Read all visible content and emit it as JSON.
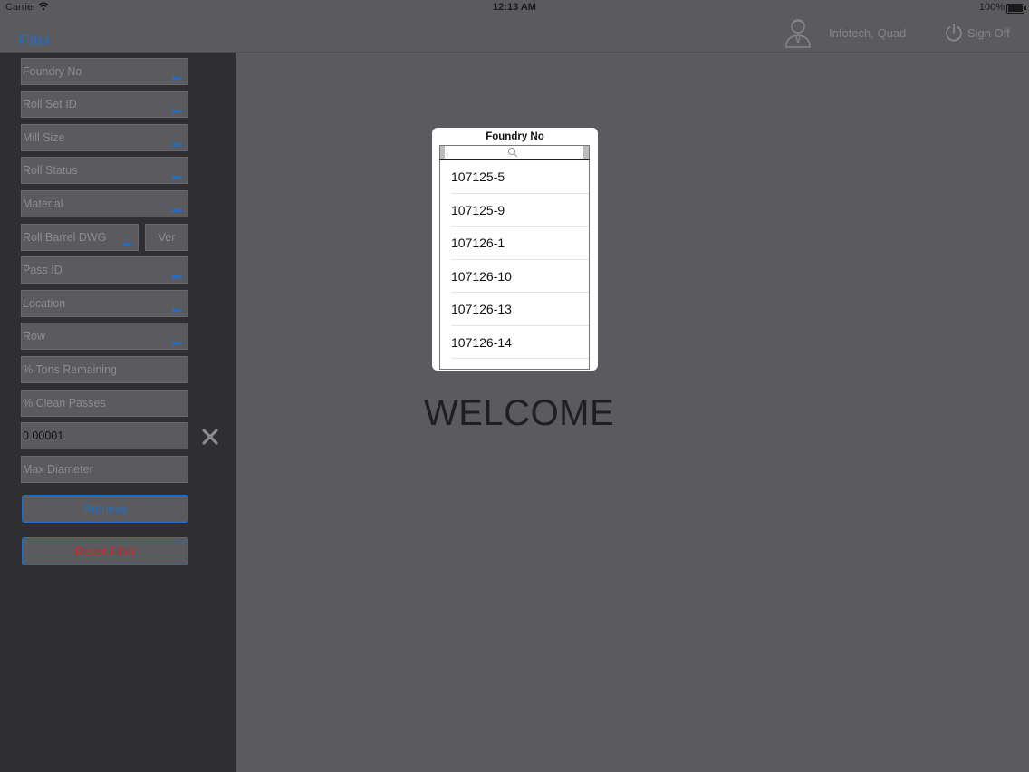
{
  "status_bar": {
    "carrier": "Carrier",
    "time": "12:13 AM",
    "battery": "100%"
  },
  "nav": {
    "filter_label": "Filter",
    "username": "Infotech, Quad",
    "sign_off": "Sign Off"
  },
  "filters": {
    "foundry_no": "Foundry No",
    "roll_set_id": "Roll Set ID",
    "mill_size": "Mill Size",
    "roll_status": "Roll Status",
    "material": "Material",
    "roll_barrel_dwg": "Roll Barrel DWG",
    "ver": "Ver",
    "pass_id": "Pass ID",
    "location": "Location",
    "row": "Row",
    "tons_remaining": "% Tons Remaining",
    "clean_passes": "% Clean Passes",
    "min_diameter_value": "0.00001",
    "max_diameter": "Max Diameter",
    "dots": "•••"
  },
  "buttons": {
    "retrieve": "Retrieve",
    "reset": "Reset Filter"
  },
  "welcome": "WELCOME",
  "popover": {
    "title": "Foundry No",
    "items": [
      "107125-5",
      "107125-9",
      "107126-1",
      "107126-10",
      "107126-13",
      "107126-14"
    ]
  },
  "icons": {
    "user": "user-icon",
    "power": "power-icon",
    "clear": "close-icon",
    "search": "search-icon",
    "wifi": "wifi-icon",
    "battery": "battery-icon"
  },
  "colors": {
    "accent": "#1f6fc7",
    "danger": "#c22a2a",
    "sidebar": "#2f2f32",
    "background": "#5b5a5f"
  }
}
